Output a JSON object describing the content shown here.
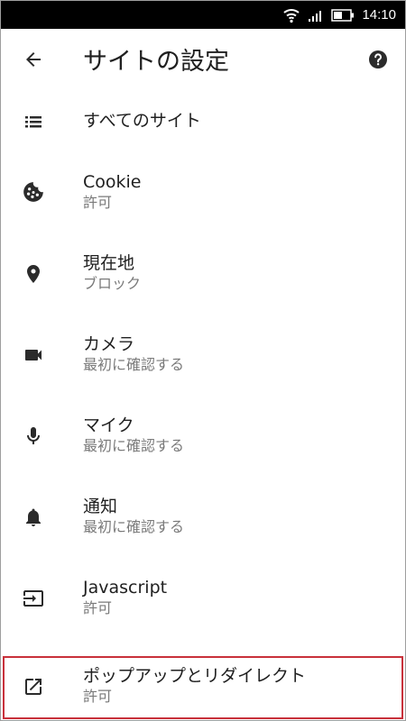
{
  "status_bar": {
    "time": "14:10"
  },
  "app_bar": {
    "title": "サイトの設定"
  },
  "items": [
    {
      "label": "すべてのサイト",
      "status": ""
    },
    {
      "label": "Cookie",
      "status": "許可"
    },
    {
      "label": "現在地",
      "status": "ブロック"
    },
    {
      "label": "カメラ",
      "status": "最初に確認する"
    },
    {
      "label": "マイク",
      "status": "最初に確認する"
    },
    {
      "label": "通知",
      "status": "最初に確認する"
    },
    {
      "label": "Javascript",
      "status": "許可"
    },
    {
      "label": "ポップアップとリダイレクト",
      "status": "許可"
    }
  ],
  "colors": {
    "icon": "#2b2b2b",
    "highlight_border": "#c8313b",
    "secondary_text": "#7a7a7a"
  }
}
